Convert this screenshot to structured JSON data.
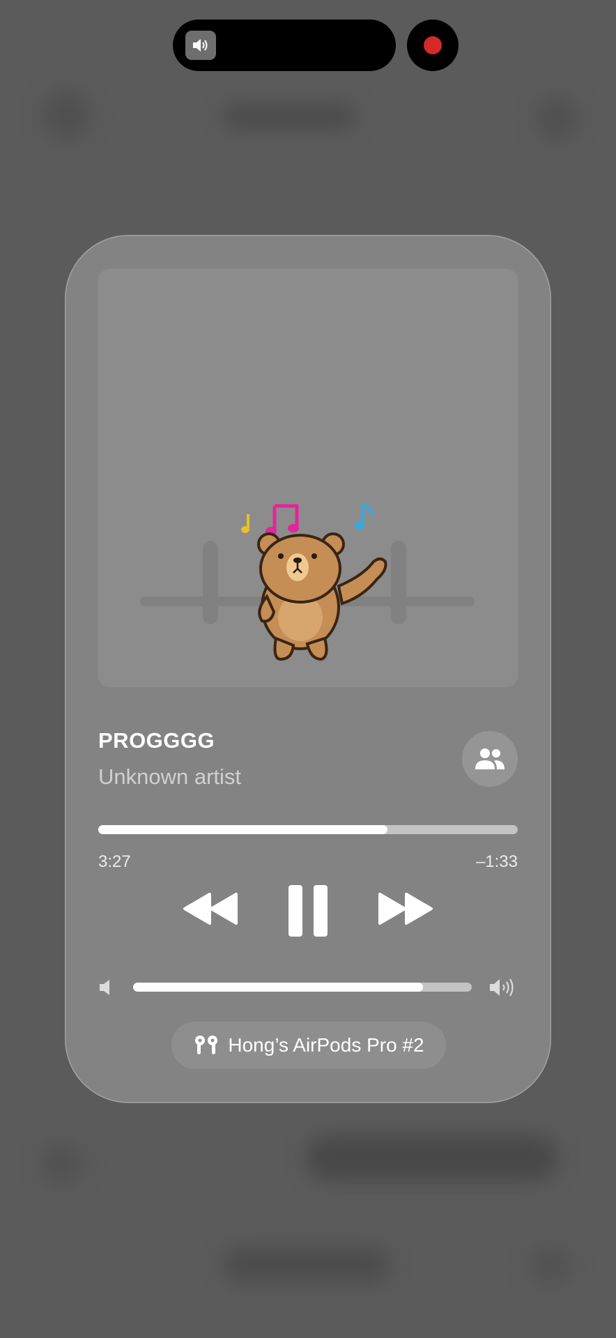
{
  "dynamic_island": {
    "left_icon": "speaker-icon",
    "right_indicator": "screen-recording-dot",
    "colors": {
      "island": "#000000",
      "recording": "#d42a2a"
    }
  },
  "player": {
    "artwork_icon": "dancing-bear-sticker",
    "track_title": "PROGGGG",
    "artist": "Unknown artist",
    "progress_fraction": 0.69,
    "elapsed": "3:27",
    "remaining": "–1:33",
    "volume_fraction": 0.855,
    "controls": {
      "rewind_icon": "backward-icon",
      "pause_icon": "pause-icon",
      "forward_icon": "forward-icon",
      "share_icon": "people-icon"
    },
    "output_device": "Hong’s AirPods Pro #2",
    "output_icon": "airpods-icon"
  },
  "colors": {
    "background": "#5b5b5b",
    "card": "#838383",
    "accent": "#ffffff"
  }
}
